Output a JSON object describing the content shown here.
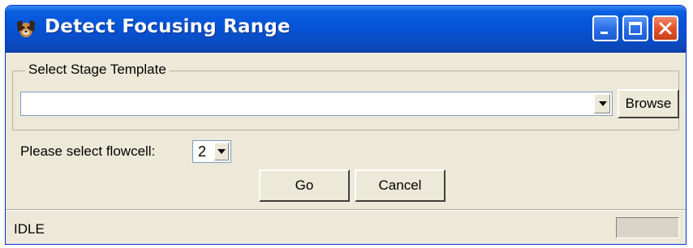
{
  "window": {
    "title": "Detect Focusing Range",
    "icon": "dog-app-icon",
    "controls": [
      "minimize-icon",
      "maximize-icon",
      "close-icon"
    ]
  },
  "stage_template": {
    "group_label": "Select Stage Template",
    "value": "",
    "browse_label": "Browse"
  },
  "flowcell": {
    "label": "Please select flowcell:",
    "selected": "2"
  },
  "actions": {
    "go_label": "Go",
    "cancel_label": "Cancel"
  },
  "status": {
    "text": "IDLE"
  },
  "colors": {
    "titlebar": "#0554d8",
    "window_bg": "#ece9d8",
    "close_button": "#e2532c"
  }
}
